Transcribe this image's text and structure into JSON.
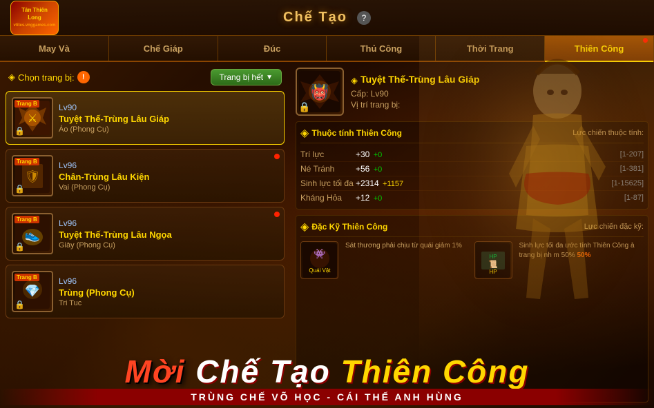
{
  "header": {
    "title": "Chế Tạo",
    "help_label": "?",
    "logo_line1": "Tân Thiên",
    "logo_line2": "Long",
    "logo_sub": "vtites.vnggames.com"
  },
  "tabs": [
    {
      "id": "may-va",
      "label": "May Và",
      "active": false
    },
    {
      "id": "che-giap",
      "label": "Chế Giáp",
      "active": false
    },
    {
      "id": "duc",
      "label": "Đúc",
      "active": false
    },
    {
      "id": "thu-cong",
      "label": "Thủ Công",
      "active": false
    },
    {
      "id": "thoi-trang",
      "label": "Thời Trang",
      "active": false
    },
    {
      "id": "thien-cong",
      "label": "Thiên Công",
      "active": true
    }
  ],
  "left_panel": {
    "header_label": "Chọn trang bị:",
    "dropdown_label": "Trang bị hết",
    "items": [
      {
        "level": "Lv90",
        "name": "Tuyệt Thế-Trùng Lâu Giáp",
        "type": "Áo (Phong Cụ)",
        "badge": "Trang B",
        "selected": true,
        "has_dot": false
      },
      {
        "level": "Lv96",
        "name": "Chân-Trùng Lâu Kiện",
        "type": "Vai (Phong Cụ)",
        "badge": "Trang B",
        "selected": false,
        "has_dot": true
      },
      {
        "level": "Lv96",
        "name": "Tuyệt Thế-Trùng Lâu Ngọa",
        "type": "Giày (Phong Cụ)",
        "badge": "Trang B",
        "selected": false,
        "has_dot": true
      },
      {
        "level": "Lv96",
        "name": "Trùng (Phong Cụ)",
        "type": "Tri Tuc",
        "badge": "Trang B",
        "selected": false,
        "has_dot": false
      }
    ]
  },
  "right_panel": {
    "item_name": "Tuyệt Thế-Trùng Lâu Giáp",
    "item_level": "Cấp: Lv90",
    "item_position": "Vị trí trang bị:",
    "thuoc_tinh_title": "Thuộc tính Thiên Công",
    "luc_chien_title": "Lực chiến thuộc tính:",
    "stats": [
      {
        "name": "Trí lực",
        "value": "+30",
        "bonus": "+0",
        "range": "[1-207]"
      },
      {
        "name": "Né Tránh",
        "value": "+56",
        "bonus": "+0",
        "range": "[1-381]"
      },
      {
        "name": "Sinh lực tối đa",
        "value": "+2314",
        "bonus": "+1157",
        "range": "[1-15625]"
      },
      {
        "name": "Kháng Hỏa",
        "value": "+12",
        "bonus": "+0",
        "range": "[1-87]"
      }
    ],
    "dac_ky_title": "Đặc Kỹ Thiên Công",
    "dac_ky_subtitle": "Lực chiến đặc kỹ:",
    "skills": [
      {
        "label": "Quái Vật",
        "desc": "Sát thương phải chịu từ quái giảm 1%"
      },
      {
        "label": "HP",
        "desc": "Sinh lực tối đa ước tính Thiên Công à trang bị nh m 50%"
      }
    ]
  },
  "bottom_banner": {
    "main_text_1": "Mời Chế Tạo",
    "main_text_2": "Thiên Công",
    "sub_text": "TRÙNG CHẾ VÕ HỌC - CÁI THẾ ANH HÙNG"
  }
}
